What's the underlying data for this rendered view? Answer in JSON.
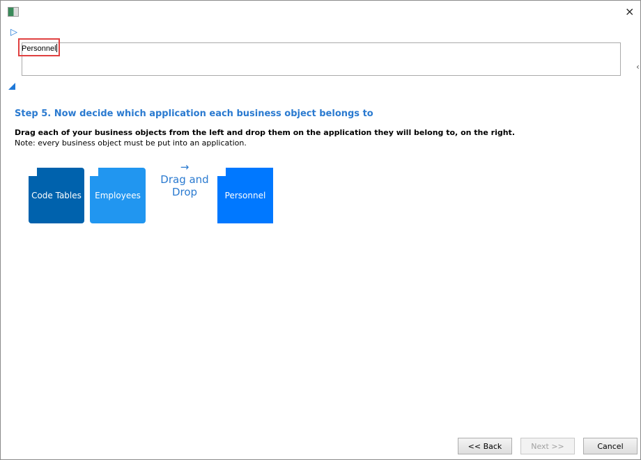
{
  "window": {
    "close_icon": "×"
  },
  "name_field": {
    "value": "Personnel"
  },
  "step": {
    "title": "Step 5. Now decide which application each business object belongs to",
    "instruction": "Drag each of your business objects from the left and drop them on the application they will belong to, on the right.",
    "note": "Note: every business object must be put into an application."
  },
  "business_objects": [
    {
      "label": "Code Tables",
      "color": "#0062ad"
    },
    {
      "label": "Employees",
      "color": "#2196f0"
    }
  ],
  "drag_hint": {
    "arrow": "→",
    "label": "Drag and Drop"
  },
  "applications": [
    {
      "label": "Personnel",
      "color": "#0078ff"
    }
  ],
  "buttons": {
    "back": "<< Back",
    "next": "Next >>",
    "cancel": "Cancel"
  }
}
